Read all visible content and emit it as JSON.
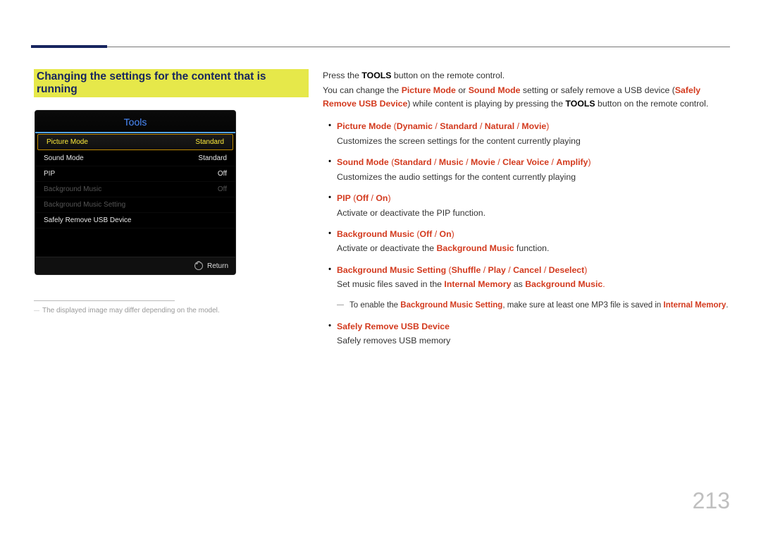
{
  "page_number": "213",
  "section_title": "Changing the settings for the content that is running",
  "tools_panel": {
    "title": "Tools",
    "rows": [
      {
        "label": "Picture Mode",
        "value": "Standard",
        "style": "sel"
      },
      {
        "label": "Sound Mode",
        "value": "Standard",
        "style": ""
      },
      {
        "label": "PIP",
        "value": "Off",
        "style": ""
      },
      {
        "label": "Background Music",
        "value": "Off",
        "style": "dim"
      },
      {
        "label": "Background Music Setting",
        "value": "",
        "style": "dim"
      },
      {
        "label": "Safely Remove USB Device",
        "value": "",
        "style": ""
      }
    ],
    "return_label": "Return"
  },
  "left_note": "The displayed image may differ depending on the model.",
  "intro": {
    "line1_pre": "Press the ",
    "line1_bold": "TOOLS",
    "line1_post": " button on the remote control.",
    "line2_pre": "You can change the ",
    "pm": "Picture Mode",
    "or": " or ",
    "sm": "Sound Mode",
    "mid": " setting or safely remove a USB device (",
    "sr": "Safely Remove USB Device",
    "post1": ") while content is playing by pressing the ",
    "tools": "TOOLS",
    "post2": " button on the remote control."
  },
  "bullets": {
    "picture_mode": {
      "label": "Picture Mode",
      "op": " (",
      "o1": "Dynamic",
      "s": " / ",
      "o2": "Standard",
      "o3": "Natural",
      "o4": "Movie",
      "cp": ")",
      "desc": "Customizes the screen settings for the content currently playing"
    },
    "sound_mode": {
      "label": "Sound Mode",
      "op": " (",
      "o1": "Standard",
      "s": " / ",
      "o2": "Music",
      "o3": "Movie",
      "o4": "Clear Voice",
      "o5": "Amplify",
      "cp": ")",
      "desc": "Customizes the audio settings for the content currently playing"
    },
    "pip": {
      "label": "PIP",
      "op": " (",
      "o1": "Off",
      "s": " / ",
      "o2": "On",
      "cp": ")",
      "desc": "Activate or deactivate the PIP function."
    },
    "bgm": {
      "label": "Background Music",
      "op": " (",
      "o1": "Off",
      "s": " / ",
      "o2": "On",
      "cp": ")",
      "desc_pre": "Activate or deactivate the ",
      "desc_hl": "Background Music",
      "desc_post": " function."
    },
    "bgm_setting": {
      "label": "Background Music Setting",
      "op": " (",
      "o1": "Shuffle",
      "s": " / ",
      "o2": "Play",
      "o3": "Cancel",
      "o4": "Deselect",
      "cp": ")",
      "desc_pre": "Set music files saved in the ",
      "im": "Internal Memory",
      "as": " as ",
      "bm": "Background Music",
      "dot": "."
    },
    "bgm_note": {
      "pre": "To enable the ",
      "bms": "Background Music Setting",
      "mid": ", make sure at least one MP3 file is saved in ",
      "im": "Internal Memory",
      "dot": "."
    },
    "safely": {
      "label": "Safely Remove USB Device",
      "desc": "Safely removes USB memory"
    }
  }
}
